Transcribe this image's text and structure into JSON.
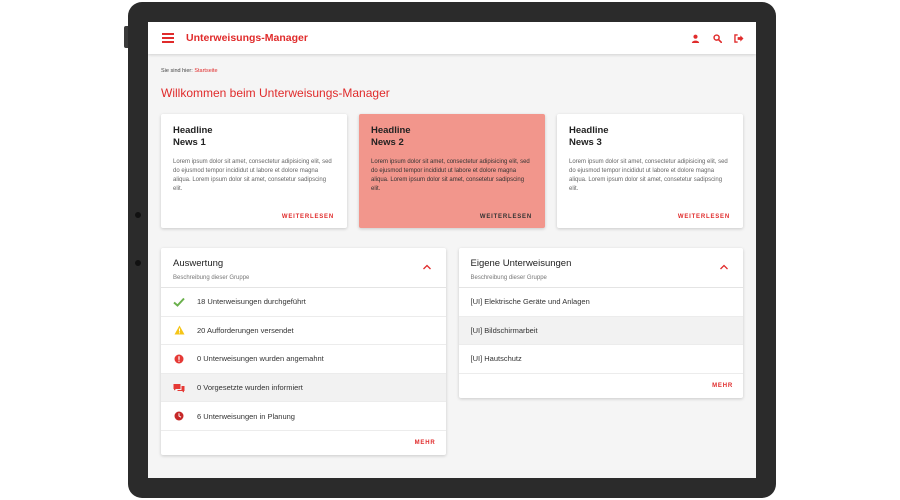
{
  "app": {
    "title": "Unterweisungs-Manager",
    "accent_color": "#e02b2b",
    "icons": [
      "menu-icon",
      "user-icon",
      "search-icon",
      "logout-icon"
    ]
  },
  "breadcrumb": {
    "prefix": "Sie sind hier:",
    "current": "Startseite"
  },
  "welcome": "Willkommen beim Unterweisungs-Manager",
  "news": [
    {
      "head1": "Headline",
      "head2": "News 1",
      "body": "Lorem ipsum dolor sit amet, consectetur adipisicing elit, sed do ejusmod tempor incididut ut labore et dolore magna aliqua. Lorem ipsum dolor sit amet, consetetur sadipscing elit.",
      "more": "WEITERLESEN"
    },
    {
      "head1": "Headline",
      "head2": "News 2",
      "body": "Lorem ipsum dolor sit amet, consectetur adipisicing elit, sed do ejusmod tempor incididut ut labore et dolore magna aliqua. Lorem ipsum dolor sit amet, consetetur sadipscing elit.",
      "more": "WEITERLESEN"
    },
    {
      "head1": "Headline",
      "head2": "News 3",
      "body": "Lorem ipsum dolor sit amet, consectetur adipisicing elit, sed do ejusmod tempor incididut ut labore et dolore magna aliqua. Lorem ipsum dolor sit amet, consetetur sadipscing elit.",
      "more": "WEITERLESEN"
    }
  ],
  "auswertung": {
    "title": "Auswertung",
    "desc": "Beschreibung dieser Gruppe",
    "items": [
      {
        "icon": "check-icon",
        "color": "#6ab04c",
        "label": "18 Unterweisungen durchgeführt"
      },
      {
        "icon": "warning-icon",
        "color": "#f5c518",
        "label": "20 Aufforderungen versendet"
      },
      {
        "icon": "alert-icon",
        "color": "#e53935",
        "label": "0 Unterweisungen wurden angemahnt"
      },
      {
        "icon": "chat-icon",
        "color": "#e53935",
        "label": "0 Vorgesetzte wurden informiert"
      },
      {
        "icon": "clock-icon",
        "color": "#c62828",
        "label": "6 Unterweisungen in Planung"
      }
    ],
    "more": "MEHR"
  },
  "eigene": {
    "title": "Eigene Unterweisungen",
    "desc": "Beschreibung dieser Gruppe",
    "items": [
      {
        "label": "[UI] Elektrische Geräte und Anlagen"
      },
      {
        "label": "[UI] Bildschirmarbeit"
      },
      {
        "label": "[UI] Hautschutz"
      }
    ],
    "more": "MEHR"
  }
}
